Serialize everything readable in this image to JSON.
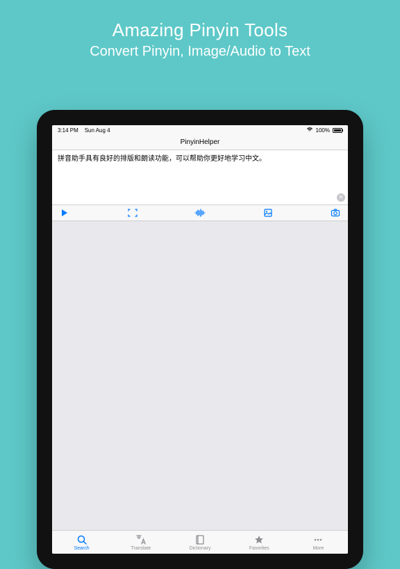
{
  "hero": {
    "title": "Amazing Pinyin Tools",
    "subtitle": "Convert Pinyin, Image/Audio to Text"
  },
  "statusbar": {
    "time": "3:14 PM",
    "date": "Sun Aug 4",
    "battery": "100%"
  },
  "navbar": {
    "title": "PinyinHelper"
  },
  "textarea": {
    "content": "拼音助手具有良好的排版和朗读功能，可以帮助你更好地学习中文。"
  },
  "tabs": {
    "search": "Search",
    "translate": "Translate",
    "dictionary": "Dictionary",
    "favorites": "Favorites",
    "more": "More"
  }
}
